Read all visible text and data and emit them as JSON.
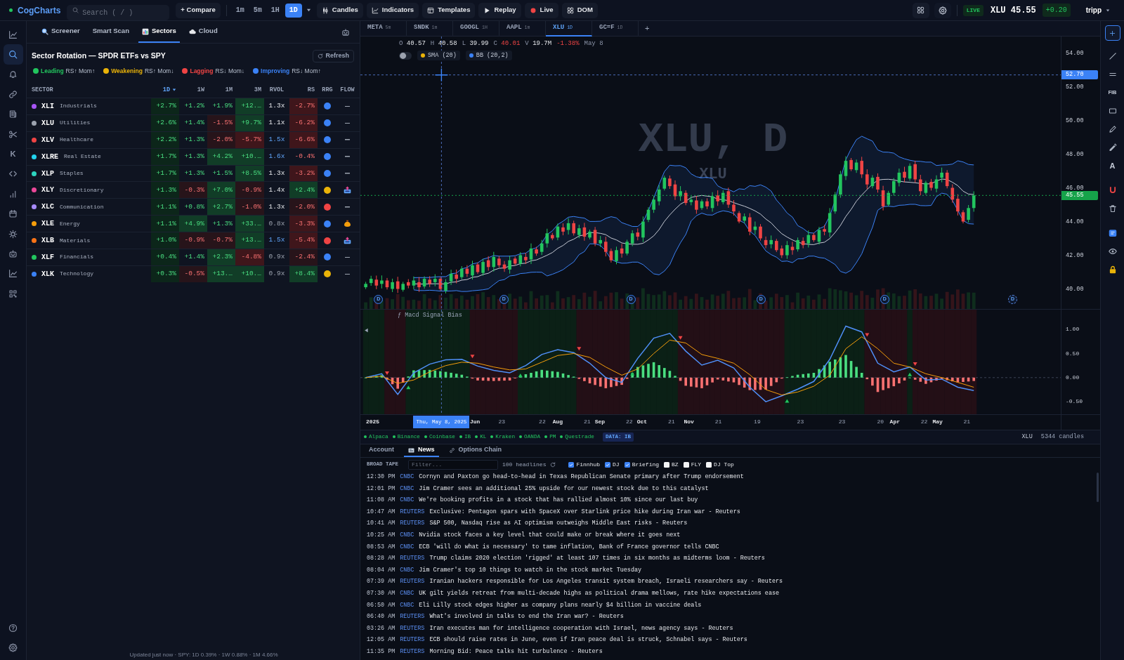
{
  "top_bar": {
    "logo": "CogCharts",
    "search": {
      "placeholder": "Search ( / )"
    },
    "compare": {
      "icon": "+",
      "label": "Compare"
    },
    "intervals": [
      {
        "label": "1m",
        "selected": false
      },
      {
        "label": "5m",
        "selected": false
      },
      {
        "label": "1H",
        "selected": false
      },
      {
        "label": "1D",
        "selected": true
      }
    ],
    "tools": [
      {
        "kind": "candles",
        "label": "Candles"
      },
      {
        "kind": "indicators",
        "label": "Indicators"
      },
      {
        "kind": "templates",
        "label": "Templates"
      },
      {
        "kind": "replay",
        "label": "Replay"
      },
      {
        "kind": "live",
        "label": "Live"
      },
      {
        "kind": "dom",
        "label": "DOM"
      }
    ],
    "status": "LIVE",
    "quote": "XLU 45.55",
    "change": "+0.20",
    "user": "tripp"
  },
  "rail": {
    "items": [
      {
        "kind": "chart",
        "selected": false
      },
      {
        "kind": "search",
        "selected": true
      },
      {
        "kind": "bell",
        "selected": false
      },
      {
        "kind": "link",
        "selected": false
      },
      {
        "kind": "news",
        "selected": false
      },
      {
        "kind": "scissors",
        "selected": false
      },
      {
        "kind": "letter",
        "label": "K",
        "selected": false
      },
      {
        "kind": "code",
        "selected": false
      },
      {
        "kind": "bars",
        "selected": false
      },
      {
        "kind": "calendar",
        "selected": false
      },
      {
        "kind": "sun",
        "selected": false
      },
      {
        "kind": "robot",
        "selected": false
      },
      {
        "kind": "trend",
        "selected": false
      },
      {
        "kind": "grid",
        "selected": false
      }
    ],
    "bottom": [
      {
        "kind": "help"
      },
      {
        "kind": "settings"
      }
    ]
  },
  "sector_panel": {
    "tabs": [
      {
        "kind": "search",
        "label": "Screener",
        "selected": false
      },
      {
        "kind": "plain",
        "label": "Smart Scan",
        "selected": false
      },
      {
        "kind": "bars",
        "label": "Sectors",
        "selected": true
      },
      {
        "kind": "cloud",
        "label": "Cloud",
        "selected": false
      }
    ],
    "title": "Sector Rotation — SPDR ETFs vs SPY",
    "refresh": "Refresh",
    "legend": [
      {
        "label": "Leading",
        "hint": "RS↑ Mom↑",
        "color": "#22c55e"
      },
      {
        "label": "Weakening",
        "hint": "RS↑ Mom↓",
        "color": "#eab308"
      },
      {
        "label": "Lagging",
        "hint": "RS↓ Mom↓",
        "color": "#ef4444"
      },
      {
        "label": "Improving",
        "hint": "RS↓ Mom↑",
        "color": "#3b82f6"
      }
    ],
    "columns": [
      {
        "label": "SECTOR",
        "sorted": false
      },
      {
        "label": "1D",
        "sorted": true
      },
      {
        "label": "1W",
        "sorted": false
      },
      {
        "label": "1M",
        "sorted": false
      },
      {
        "label": "3M",
        "sorted": false
      },
      {
        "label": "RVOL",
        "sorted": false
      },
      {
        "label": "RS",
        "sorted": false
      },
      {
        "label": "RRG",
        "sorted": false
      },
      {
        "label": "FLOW",
        "sorted": false
      }
    ],
    "rows": [
      {
        "color": "#a855f7",
        "ticker": "XLI",
        "name": "Industrials",
        "changes": [
          {
            "text": "+2.7%",
            "kind": "uplight"
          },
          {
            "text": "+1.2%",
            "kind": "up"
          },
          {
            "text": "+1.9%",
            "kind": "up"
          },
          {
            "text": "+12.…",
            "kind": "upstrong"
          }
        ],
        "rvol": {
          "text": "1.3x",
          "kind": "normal"
        },
        "rs": {
          "text": "-2.7%",
          "kind": "downstrong"
        },
        "rrg": {
          "color": "#3b82f6"
        },
        "flow": {
          "kind": "none"
        }
      },
      {
        "color": "#9ca3af",
        "ticker": "XLU",
        "name": "Utilities",
        "changes": [
          {
            "text": "+2.6%",
            "kind": "uplight"
          },
          {
            "text": "+1.4%",
            "kind": "up"
          },
          {
            "text": "-1.5%",
            "kind": "downlight"
          },
          {
            "text": "+9.7%",
            "kind": "upstrong"
          }
        ],
        "rvol": {
          "text": "1.1x",
          "kind": "normal"
        },
        "rs": {
          "text": "-6.2%",
          "kind": "downstrong"
        },
        "rrg": {
          "color": "#3b82f6"
        },
        "flow": {
          "kind": "none"
        }
      },
      {
        "color": "#ef4444",
        "ticker": "XLV",
        "name": "Healthcare",
        "changes": [
          {
            "text": "+2.2%",
            "kind": "uplight"
          },
          {
            "text": "+1.3%",
            "kind": "up"
          },
          {
            "text": "-2.0%",
            "kind": "downlight"
          },
          {
            "text": "-5.7%",
            "kind": "downstrong"
          }
        ],
        "rvol": {
          "text": "1.5x",
          "kind": "high"
        },
        "rs": {
          "text": "-6.6%",
          "kind": "downstrong"
        },
        "rrg": {
          "color": "#3b82f6"
        },
        "flow": {
          "kind": "none"
        }
      },
      {
        "color": "#22d3ee",
        "ticker": "XLRE",
        "name": "Real Estate",
        "changes": [
          {
            "text": "+1.7%",
            "kind": "uplight"
          },
          {
            "text": "+1.3%",
            "kind": "up"
          },
          {
            "text": "+4.2%",
            "kind": "upstrong"
          },
          {
            "text": "+10.…",
            "kind": "upstrong"
          }
        ],
        "rvol": {
          "text": "1.6x",
          "kind": "high"
        },
        "rs": {
          "text": "-0.4%",
          "kind": "down"
        },
        "rrg": {
          "color": "#3b82f6"
        },
        "flow": {
          "kind": "none"
        }
      },
      {
        "color": "#2dd4bf",
        "ticker": "XLP",
        "name": "Staples",
        "changes": [
          {
            "text": "+1.7%",
            "kind": "uplight"
          },
          {
            "text": "+1.3%",
            "kind": "up"
          },
          {
            "text": "+1.5%",
            "kind": "up"
          },
          {
            "text": "+8.5%",
            "kind": "upstrong"
          }
        ],
        "rvol": {
          "text": "1.3x",
          "kind": "normal"
        },
        "rs": {
          "text": "-3.2%",
          "kind": "downstrong"
        },
        "rrg": {
          "color": "#3b82f6"
        },
        "flow": {
          "kind": "none"
        }
      },
      {
        "color": "#ec4899",
        "ticker": "XLY",
        "name": "Discretionary",
        "changes": [
          {
            "text": "+1.3%",
            "kind": "uplight"
          },
          {
            "text": "-0.3%",
            "kind": "downlight"
          },
          {
            "text": "+7.0%",
            "kind": "upstrong"
          },
          {
            "text": "-0.9%",
            "kind": "downlight"
          }
        ],
        "rvol": {
          "text": "1.4x",
          "kind": "normal"
        },
        "rs": {
          "text": "+2.4%",
          "kind": "upstrong"
        },
        "rrg": {
          "color": "#eab308"
        },
        "flow": {
          "kind": "tray"
        }
      },
      {
        "color": "#a78bfa",
        "ticker": "XLC",
        "name": "Communication",
        "changes": [
          {
            "text": "+1.1%",
            "kind": "uplight"
          },
          {
            "text": "+0.8%",
            "kind": "up"
          },
          {
            "text": "+2.7%",
            "kind": "upstrong"
          },
          {
            "text": "-1.0%",
            "kind": "downlight"
          }
        ],
        "rvol": {
          "text": "1.3x",
          "kind": "normal"
        },
        "rs": {
          "text": "-2.0%",
          "kind": "downlight"
        },
        "rrg": {
          "color": "#ef4444"
        },
        "flow": {
          "kind": "none"
        }
      },
      {
        "color": "#f59e0b",
        "ticker": "XLE",
        "name": "Energy",
        "changes": [
          {
            "text": "+1.1%",
            "kind": "uplight"
          },
          {
            "text": "+4.9%",
            "kind": "upstrong"
          },
          {
            "text": "+1.3%",
            "kind": "up"
          },
          {
            "text": "+33.…",
            "kind": "upstrong"
          }
        ],
        "rvol": {
          "text": "0.8x",
          "kind": "low"
        },
        "rs": {
          "text": "-3.3%",
          "kind": "downstrong"
        },
        "rrg": {
          "color": "#3b82f6"
        },
        "flow": {
          "kind": "moneybag"
        }
      },
      {
        "color": "#f97316",
        "ticker": "XLB",
        "name": "Materials",
        "changes": [
          {
            "text": "+1.0%",
            "kind": "uplight"
          },
          {
            "text": "-0.9%",
            "kind": "downlight"
          },
          {
            "text": "-0.7%",
            "kind": "downlight"
          },
          {
            "text": "+13.…",
            "kind": "upstrong"
          }
        ],
        "rvol": {
          "text": "1.5x",
          "kind": "high"
        },
        "rs": {
          "text": "-5.4%",
          "kind": "downstrong"
        },
        "rrg": {
          "color": "#ef4444"
        },
        "flow": {
          "kind": "tray"
        }
      },
      {
        "color": "#22c55e",
        "ticker": "XLF",
        "name": "Financials",
        "changes": [
          {
            "text": "+0.4%",
            "kind": "uplight"
          },
          {
            "text": "+1.4%",
            "kind": "up"
          },
          {
            "text": "+2.3%",
            "kind": "upstrong"
          },
          {
            "text": "-4.8%",
            "kind": "downstrong"
          }
        ],
        "rvol": {
          "text": "0.9x",
          "kind": "low"
        },
        "rs": {
          "text": "-2.4%",
          "kind": "downlight"
        },
        "rrg": {
          "color": "#3b82f6"
        },
        "flow": {
          "kind": "none"
        }
      },
      {
        "color": "#3b82f6",
        "ticker": "XLK",
        "name": "Technology",
        "changes": [
          {
            "text": "+0.3%",
            "kind": "uplight"
          },
          {
            "text": "-0.5%",
            "kind": "downlight"
          },
          {
            "text": "+13.…",
            "kind": "upstrong"
          },
          {
            "text": "+10.…",
            "kind": "upstrong"
          }
        ],
        "rvol": {
          "text": "0.9x",
          "kind": "low"
        },
        "rs": {
          "text": "+8.4%",
          "kind": "upstrong"
        },
        "rrg": {
          "color": "#eab308"
        },
        "flow": {
          "kind": "none"
        }
      }
    ],
    "footer": "Updated just now · SPY: 1D 0.39% · 1W 0.88% · 1M 4.66%"
  },
  "chart_tabs": {
    "tabs": [
      {
        "symbol": "META",
        "interval": "5m",
        "selected": false
      },
      {
        "symbol": "SNDK",
        "interval": "1m",
        "selected": false
      },
      {
        "symbol": "GOOGL",
        "interval": "1H",
        "selected": false
      },
      {
        "symbol": "AAPL",
        "interval": "1m",
        "selected": false
      },
      {
        "symbol": "XLU",
        "interval": "1D",
        "selected": true
      },
      {
        "symbol": "GC=F",
        "interval": "1D",
        "selected": false
      }
    ],
    "add": "+"
  },
  "chart": {
    "readout": {
      "fields": [
        {
          "kind": "plain",
          "label": "O",
          "value": "40.57"
        },
        {
          "kind": "plain",
          "label": "H",
          "value": "40.58"
        },
        {
          "kind": "plain",
          "label": "L",
          "value": "39.99"
        },
        {
          "kind": "close",
          "label": "C",
          "value": "40.01"
        },
        {
          "kind": "plain",
          "label": "V",
          "value": "19.7M"
        }
      ],
      "change": "-1.38%",
      "falling": true,
      "date": "May 8"
    },
    "toggle": {
      "on": false
    },
    "indicators": [
      {
        "label": "SMA (20)",
        "color": "#eab308"
      },
      {
        "label": "BB (20,2)",
        "color": "#3b82f6"
      }
    ],
    "watermark": "XLU, D",
    "watermark_sub": "XLU",
    "price_axis": [
      "54.00",
      "52.00",
      "50.00",
      "48.00",
      "46.00",
      "44.00",
      "42.00",
      "40.00"
    ],
    "crosshair_price": "52.70",
    "last_price": "45.55",
    "markers": [
      {
        "text": "D",
        "upcoming": false
      },
      {
        "text": "D",
        "upcoming": false
      },
      {
        "text": "D",
        "upcoming": false
      },
      {
        "text": "D",
        "upcoming": false
      },
      {
        "text": "D",
        "upcoming": false
      },
      {
        "text": "D",
        "upcoming": true
      }
    ],
    "macd": {
      "title": "ƒ Macd Signal Bias",
      "axis": [
        "1.00",
        "0.50",
        "0.00",
        "-0.50"
      ]
    },
    "time_axis": [
      {
        "label": "2025",
        "major": true
      },
      {
        "label": "Jun",
        "major": true
      },
      {
        "label": "23",
        "major": false
      },
      {
        "label": "22",
        "major": false
      },
      {
        "label": "Aug",
        "major": true
      },
      {
        "label": "21",
        "major": false
      },
      {
        "label": "Sep",
        "major": true
      },
      {
        "label": "22",
        "major": false
      },
      {
        "label": "Oct",
        "major": true
      },
      {
        "label": "21",
        "major": false
      },
      {
        "label": "Nov",
        "major": true
      },
      {
        "label": "21",
        "major": false
      },
      {
        "label": "19",
        "major": false
      },
      {
        "label": "23",
        "major": false
      },
      {
        "label": "23",
        "major": false
      },
      {
        "label": "20",
        "major": false
      },
      {
        "label": "Apr",
        "major": true
      },
      {
        "label": "22",
        "major": false
      },
      {
        "label": "May",
        "major": true
      },
      {
        "label": "21",
        "major": false
      }
    ],
    "crosshair_date": "Thu, May 8, 2025"
  },
  "drawing_tools": {
    "groups": [
      {
        "tools": [
          {
            "kind": "add"
          }
        ]
      },
      {
        "tools": [
          {
            "kind": "line"
          },
          {
            "kind": "hline"
          },
          {
            "kind": "text",
            "label": "FIB"
          },
          {
            "kind": "rect"
          },
          {
            "kind": "pencil"
          },
          {
            "kind": "marker"
          },
          {
            "kind": "text",
            "label": "A"
          }
        ]
      },
      {
        "tools": [
          {
            "kind": "magnet"
          },
          {
            "kind": "trash"
          }
        ]
      },
      {
        "tools": [
          {
            "kind": "note"
          },
          {
            "kind": "eye"
          },
          {
            "kind": "lock"
          }
        ]
      }
    ]
  },
  "data_bar": {
    "brokers": [
      {
        "name": "Alpaca",
        "connected": true
      },
      {
        "name": "Binance",
        "connected": true
      },
      {
        "name": "Coinbase",
        "connected": true
      },
      {
        "name": "IB",
        "connected": true
      },
      {
        "name": "KL",
        "connected": true
      },
      {
        "name": "Kraken",
        "connected": true
      },
      {
        "name": "OANDA",
        "connected": true
      },
      {
        "name": "PM",
        "connected": true
      },
      {
        "name": "Questrade",
        "connected": true
      }
    ],
    "source": "DATA: IB",
    "symbol": "XLU",
    "count": "5344 candles"
  },
  "bottom_tabs": [
    {
      "kind": "plain",
      "label": "Account",
      "selected": false
    },
    {
      "kind": "news",
      "label": "News",
      "selected": true
    },
    {
      "kind": "chain",
      "label": "Options Chain",
      "selected": false
    }
  ],
  "news": {
    "label": "BROAD TAPE",
    "filter": {
      "placeholder": "Filter..."
    },
    "count": "100 headlines",
    "sources": [
      {
        "label": "Finnhub",
        "checked": true
      },
      {
        "label": "DJ",
        "checked": true
      },
      {
        "label": "Briefing",
        "checked": true
      },
      {
        "label": "BZ",
        "checked": false
      },
      {
        "label": "FLY",
        "checked": false
      },
      {
        "label": "DJ Top",
        "checked": false
      }
    ],
    "items": [
      {
        "time": "12:30 PM",
        "source": "CNBC",
        "headline": "Cornyn and Paxton go head-to-head in Texas Republican Senate primary after Trump endorsement"
      },
      {
        "time": "12:01 PM",
        "source": "CNBC",
        "headline": "Jim Cramer sees an additional 25% upside for our newest stock due to this catalyst"
      },
      {
        "time": "11:08 AM",
        "source": "CNBC",
        "headline": "We're booking profits in a stock that has rallied almost 10% since our last buy"
      },
      {
        "time": "10:47 AM",
        "source": "REUTERS",
        "headline": "Exclusive: Pentagon spars with SpaceX over Starlink price hike during Iran war - Reuters"
      },
      {
        "time": "10:41 AM",
        "source": "REUTERS",
        "headline": "S&P 500, Nasdaq rise as AI optimism outweighs Middle East risks - Reuters"
      },
      {
        "time": "10:25 AM",
        "source": "CNBC",
        "headline": "Nvidia stock faces a key level that could make or break where it goes next"
      },
      {
        "time": "08:53 AM",
        "source": "CNBC",
        "headline": "ECB 'will do what is necessary' to tame inflation, Bank of France governor tells CNBC"
      },
      {
        "time": "08:28 AM",
        "source": "REUTERS",
        "headline": "Trump claims 2020 election 'rigged' at least 107 times in six months as midterms loom - Reuters"
      },
      {
        "time": "08:04 AM",
        "source": "CNBC",
        "headline": "Jim Cramer's top 10 things to watch in the stock market Tuesday"
      },
      {
        "time": "07:39 AM",
        "source": "REUTERS",
        "headline": "Iranian hackers responsible for Los Angeles transit system breach, Israeli researchers say - Reuters"
      },
      {
        "time": "07:30 AM",
        "source": "CNBC",
        "headline": "UK gilt yields retreat from multi-decade highs as political drama mellows, rate hike expectations ease"
      },
      {
        "time": "06:50 AM",
        "source": "CNBC",
        "headline": "Eli Lilly stock edges higher as company plans nearly $4 billion in vaccine deals"
      },
      {
        "time": "06:40 AM",
        "source": "REUTERS",
        "headline": "What's involved in talks to end the Iran war? - Reuters"
      },
      {
        "time": "03:26 AM",
        "source": "REUTERS",
        "headline": "Iran executes man for intelligence cooperation with Israel, news agency says - Reuters"
      },
      {
        "time": "12:05 AM",
        "source": "REUTERS",
        "headline": "ECB should raise rates in June, even if Iran peace deal is struck, Schnabel says - Reuters"
      },
      {
        "time": "11:35 PM",
        "source": "REUTERS",
        "headline": "Morning Bid: Peace talks hit turbulence - Reuters"
      }
    ]
  }
}
